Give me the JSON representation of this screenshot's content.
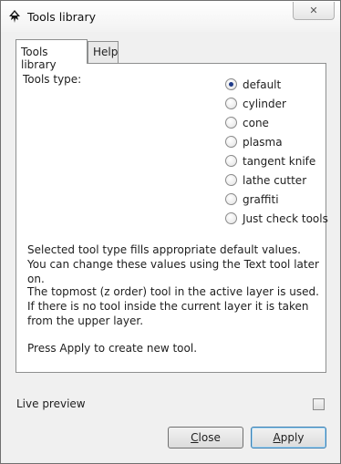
{
  "window": {
    "title": "Tools library",
    "app_icon": "inkscape-icon",
    "close_glyph": "✕"
  },
  "tabs": [
    {
      "label": "Tools library",
      "active": true
    },
    {
      "label": "Help",
      "active": false
    }
  ],
  "panel": {
    "tools_type_label": "Tools type:",
    "options": [
      {
        "label": "default",
        "checked": true
      },
      {
        "label": "cylinder",
        "checked": false
      },
      {
        "label": "cone",
        "checked": false
      },
      {
        "label": "plasma",
        "checked": false
      },
      {
        "label": "tangent knife",
        "checked": false
      },
      {
        "label": "lathe cutter",
        "checked": false
      },
      {
        "label": "graffiti",
        "checked": false
      },
      {
        "label": "Just check tools",
        "checked": false
      }
    ],
    "paragraph_1": "Selected tool type fills appropriate default values. You can change these values using the Text tool later on.",
    "paragraph_2": "The topmost (z order) tool in the active layer is used. If there is no tool inside the current layer it is taken from the upper layer.",
    "paragraph_3": "Press Apply to create new tool."
  },
  "live_preview": {
    "label": "Live preview",
    "checked": false
  },
  "buttons": {
    "close": {
      "first": "C",
      "rest": "lose"
    },
    "apply": {
      "first": "A",
      "rest": "pply"
    }
  }
}
